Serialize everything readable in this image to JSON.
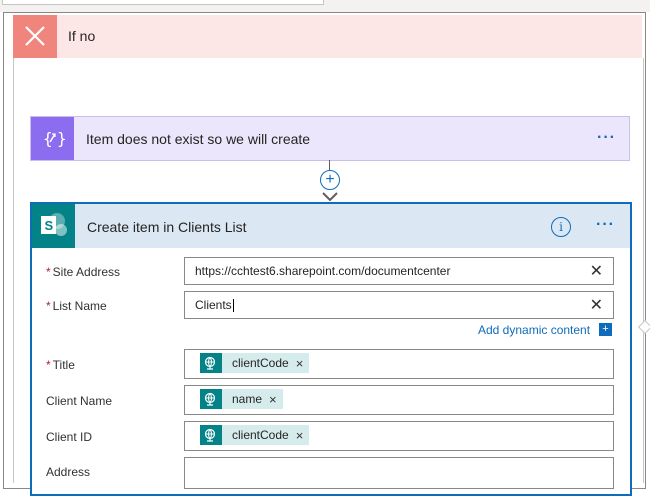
{
  "if_no": {
    "title": "If no",
    "icon": "close-icon"
  },
  "compose": {
    "title": "Item does not exist so we will create",
    "icon": "compose-icon",
    "menu": "···"
  },
  "connector": {
    "add_symbol": "+"
  },
  "sharepoint": {
    "title": "Create item in Clients List",
    "icon": "sharepoint-icon",
    "info": "i",
    "menu": "···",
    "required_mark": "*",
    "fields": {
      "site_address": {
        "label": "Site Address",
        "value": "https://cchtest6.sharepoint.com/documentcenter",
        "clear": "✕"
      },
      "list_name": {
        "label": "List Name",
        "value": "Clients",
        "clear": "✕"
      },
      "dynamic_content": {
        "label": "Add dynamic content",
        "plus": "+"
      },
      "title": {
        "label": "Title",
        "token": "clientCode",
        "remove": "×"
      },
      "client_name": {
        "label": "Client Name",
        "token": "name",
        "remove": "×"
      },
      "client_id": {
        "label": "Client ID",
        "token": "clientCode",
        "remove": "×"
      },
      "address": {
        "label": "Address",
        "value": ""
      }
    }
  },
  "colors": {
    "if_no_header": "#fde7e6",
    "if_no_icon": "#f0857d",
    "compose_bg": "#ebe6fb",
    "compose_icon": "#8c6cef",
    "sharepoint_header": "#dbe7f3",
    "sharepoint_icon": "#038387",
    "accent": "#0f6cbd"
  }
}
